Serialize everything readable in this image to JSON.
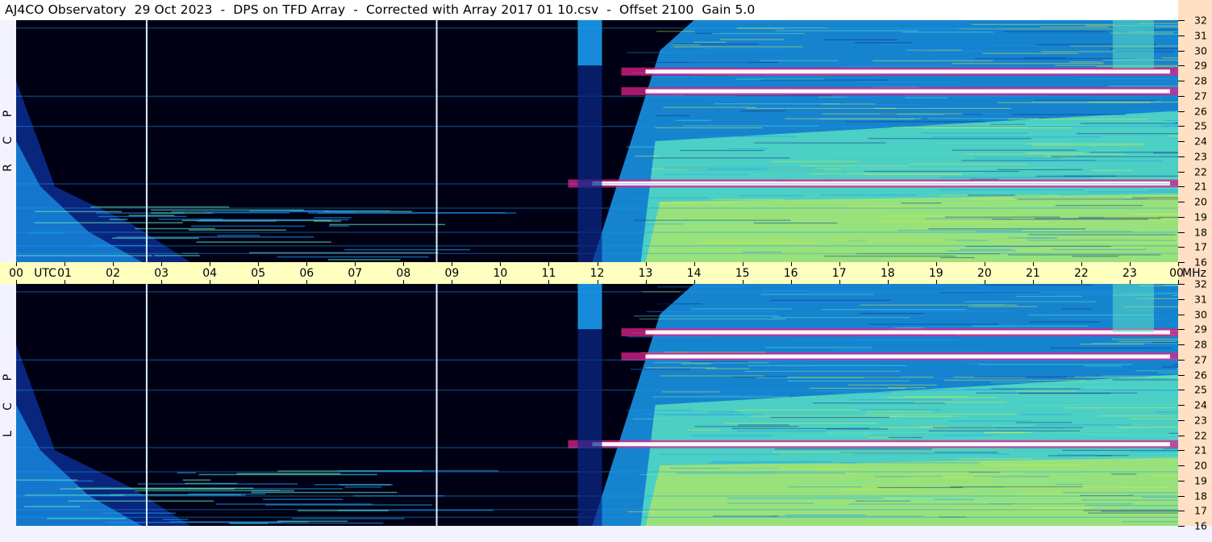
{
  "title": "AJ4CO Observatory  29 Oct 2023  -  DPS on TFD Array  -  Corrected with Array 2017 01 10.csv  -  Offset 2100  Gain 5.0",
  "panels": {
    "top_polarization": [
      "R",
      "C",
      "P"
    ],
    "bottom_polarization": [
      "L",
      "C",
      "P"
    ]
  },
  "colors": {
    "background_dark": "#000014",
    "low": "#0a2a8a",
    "mid": "#1a9af0",
    "high": "#5fe8c0",
    "very_high": "#d8f040",
    "saturation_magenta": "#e0208a",
    "saturation_white": "#ffffff",
    "time_axis_bg": "#ffffc0",
    "freq_axis_bg": "#ffe0c4"
  },
  "chart_data": [
    {
      "type": "heatmap",
      "title": "AJ4CO Observatory  29 Oct 2023  -  DPS on TFD Array  -  Corrected with Array 2017 01 10.csv  -  Offset 2100  Gain 5.0",
      "panel": "top",
      "ylabel": "R C P",
      "x_unit": "UTC",
      "y_unit": "MHz",
      "xlim": [
        0,
        24
      ],
      "ylim": [
        16,
        32
      ],
      "x_ticks": [
        "00",
        "01",
        "02",
        "03",
        "04",
        "05",
        "06",
        "07",
        "08",
        "09",
        "10",
        "11",
        "12",
        "13",
        "14",
        "15",
        "16",
        "17",
        "18",
        "19",
        "20",
        "21",
        "22",
        "23",
        "00"
      ],
      "y_ticks": [
        "16",
        "17",
        "18",
        "19",
        "20",
        "21",
        "22",
        "23",
        "24",
        "25",
        "26",
        "27",
        "28",
        "29",
        "30",
        "31",
        "32"
      ],
      "vertical_markers_utc": [
        2.68,
        8.67
      ],
      "solar_rise_band_utc": [
        11.6,
        12.1
      ],
      "bright_band_mhz": [
        21.2,
        27.3,
        28.6
      ]
    },
    {
      "type": "heatmap",
      "panel": "bottom",
      "ylabel": "L C P",
      "x_unit": "UTC",
      "y_unit": "MHz",
      "xlim": [
        0,
        24
      ],
      "ylim": [
        16,
        32
      ],
      "x_ticks": [
        "00",
        "01",
        "02",
        "03",
        "04",
        "05",
        "06",
        "07",
        "08",
        "09",
        "10",
        "11",
        "12",
        "13",
        "14",
        "15",
        "16",
        "17",
        "18",
        "19",
        "20",
        "21",
        "22",
        "23",
        "00"
      ],
      "y_ticks": [
        "16",
        "17",
        "18",
        "19",
        "20",
        "21",
        "22",
        "23",
        "24",
        "25",
        "26",
        "27",
        "28",
        "29",
        "30",
        "31",
        "32"
      ],
      "vertical_markers_utc": [
        2.68,
        8.67
      ],
      "solar_rise_band_utc": [
        11.6,
        12.1
      ],
      "bright_band_mhz": [
        21.4,
        27.2,
        28.8
      ]
    }
  ],
  "axis": {
    "utc_label": "UTC",
    "mhz_label": "MHz",
    "hour_labels": [
      "00",
      "01",
      "02",
      "03",
      "04",
      "05",
      "06",
      "07",
      "08",
      "09",
      "10",
      "11",
      "12",
      "13",
      "14",
      "15",
      "16",
      "17",
      "18",
      "19",
      "20",
      "21",
      "22",
      "23",
      "00"
    ],
    "freq_labels": [
      "32",
      "31",
      "30",
      "29",
      "28",
      "27",
      "26",
      "25",
      "24",
      "23",
      "22",
      "21",
      "20",
      "19",
      "18",
      "17",
      "16"
    ]
  }
}
